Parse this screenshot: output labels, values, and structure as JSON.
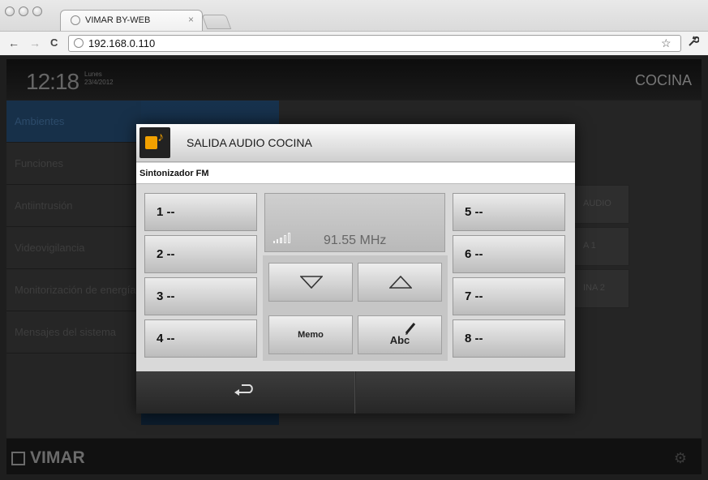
{
  "browser": {
    "tab_title": "VIMAR BY-WEB",
    "tab_close": "×",
    "url": "192.168.0.110",
    "back": "←",
    "forward": "→",
    "reload": "C",
    "star": "☆",
    "wrench": "🔧"
  },
  "app": {
    "time": "12:18",
    "day": "Lunes",
    "date": "23/4/2012",
    "room": "COCINA",
    "sidebar": [
      {
        "label": "Ambientes",
        "selected": true
      },
      {
        "label": "Funciones",
        "selected": false
      },
      {
        "label": "Antiintrusión",
        "selected": false
      },
      {
        "label": "Videovigilancia",
        "selected": false
      },
      {
        "label": "Monitorización de energía",
        "selected": false
      },
      {
        "label": "Mensajes del sistema",
        "selected": false
      }
    ],
    "right_tiles": [
      "AUDIO",
      "A 1",
      "INA 2"
    ],
    "brand": "VIMAR"
  },
  "dialog": {
    "title": "SALIDA AUDIO COCINA",
    "subtitle": "Sintonizador FM",
    "presets_left": [
      "1 --",
      "2 --",
      "3 --",
      "4 --"
    ],
    "presets_right": [
      "5 --",
      "6 --",
      "7 --",
      "8 --"
    ],
    "frequency": "91.55 MHz",
    "signal_bars": 5,
    "memo_label": "Memo",
    "abc_label": "Abc",
    "icons": {
      "header": "speaker-music-icon",
      "down": "triangle-down-icon",
      "up": "triangle-up-icon",
      "edit": "pencil-icon",
      "back": "return-arrow-icon"
    },
    "accent_color": "#f2a100"
  }
}
